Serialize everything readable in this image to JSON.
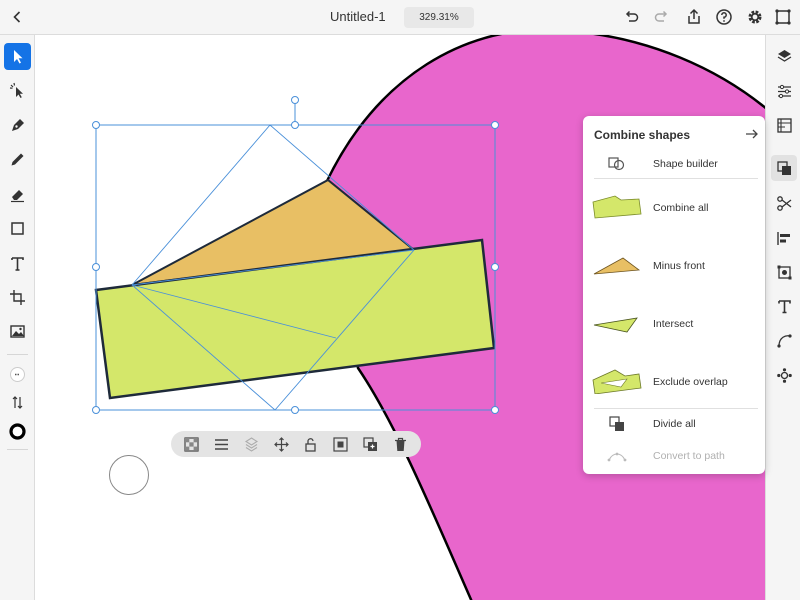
{
  "header": {
    "title": "Untitled-1",
    "zoom": "329.31%"
  },
  "panel": {
    "title": "Combine shapes",
    "items": [
      {
        "label": "Shape builder",
        "enabled": true
      },
      {
        "label": "Combine all",
        "enabled": true
      },
      {
        "label": "Minus front",
        "enabled": true
      },
      {
        "label": "Intersect",
        "enabled": true
      },
      {
        "label": "Exclude overlap",
        "enabled": true
      },
      {
        "label": "Divide all",
        "enabled": true
      },
      {
        "label": "Convert to path",
        "enabled": false
      }
    ]
  },
  "colors": {
    "accent": "#1473e6",
    "pink_shape": "#e866cc",
    "green_shape": "#d4e76a",
    "orange_shape": "#e8bf64",
    "selection": "#4a90d9"
  },
  "icons": {
    "top_left": [
      "back-icon"
    ],
    "top_right": [
      "undo-icon",
      "redo-icon",
      "share-icon",
      "help-icon",
      "settings-icon",
      "plugins-icon"
    ],
    "left_tools": [
      "select-icon",
      "direct-select-icon",
      "pen-icon",
      "pencil-icon",
      "eraser-icon",
      "rectangle-icon",
      "text-icon",
      "transform-icon",
      "image-icon",
      "stroke-weight-icon",
      "swap-icon",
      "stroke-color-icon"
    ],
    "right_tools": [
      "layers-icon",
      "properties-icon",
      "libraries-icon",
      "combine-shapes-icon",
      "scissors-icon",
      "align-icon",
      "transform-panel-icon",
      "type-icon",
      "path-icon",
      "repeat-grid-icon"
    ],
    "action_bar": [
      "checkerboard-icon",
      "menu-icon",
      "layer-stack-icon",
      "move-icon",
      "unlock-icon",
      "arrange-back-icon",
      "add-layer-icon",
      "delete-icon"
    ]
  }
}
